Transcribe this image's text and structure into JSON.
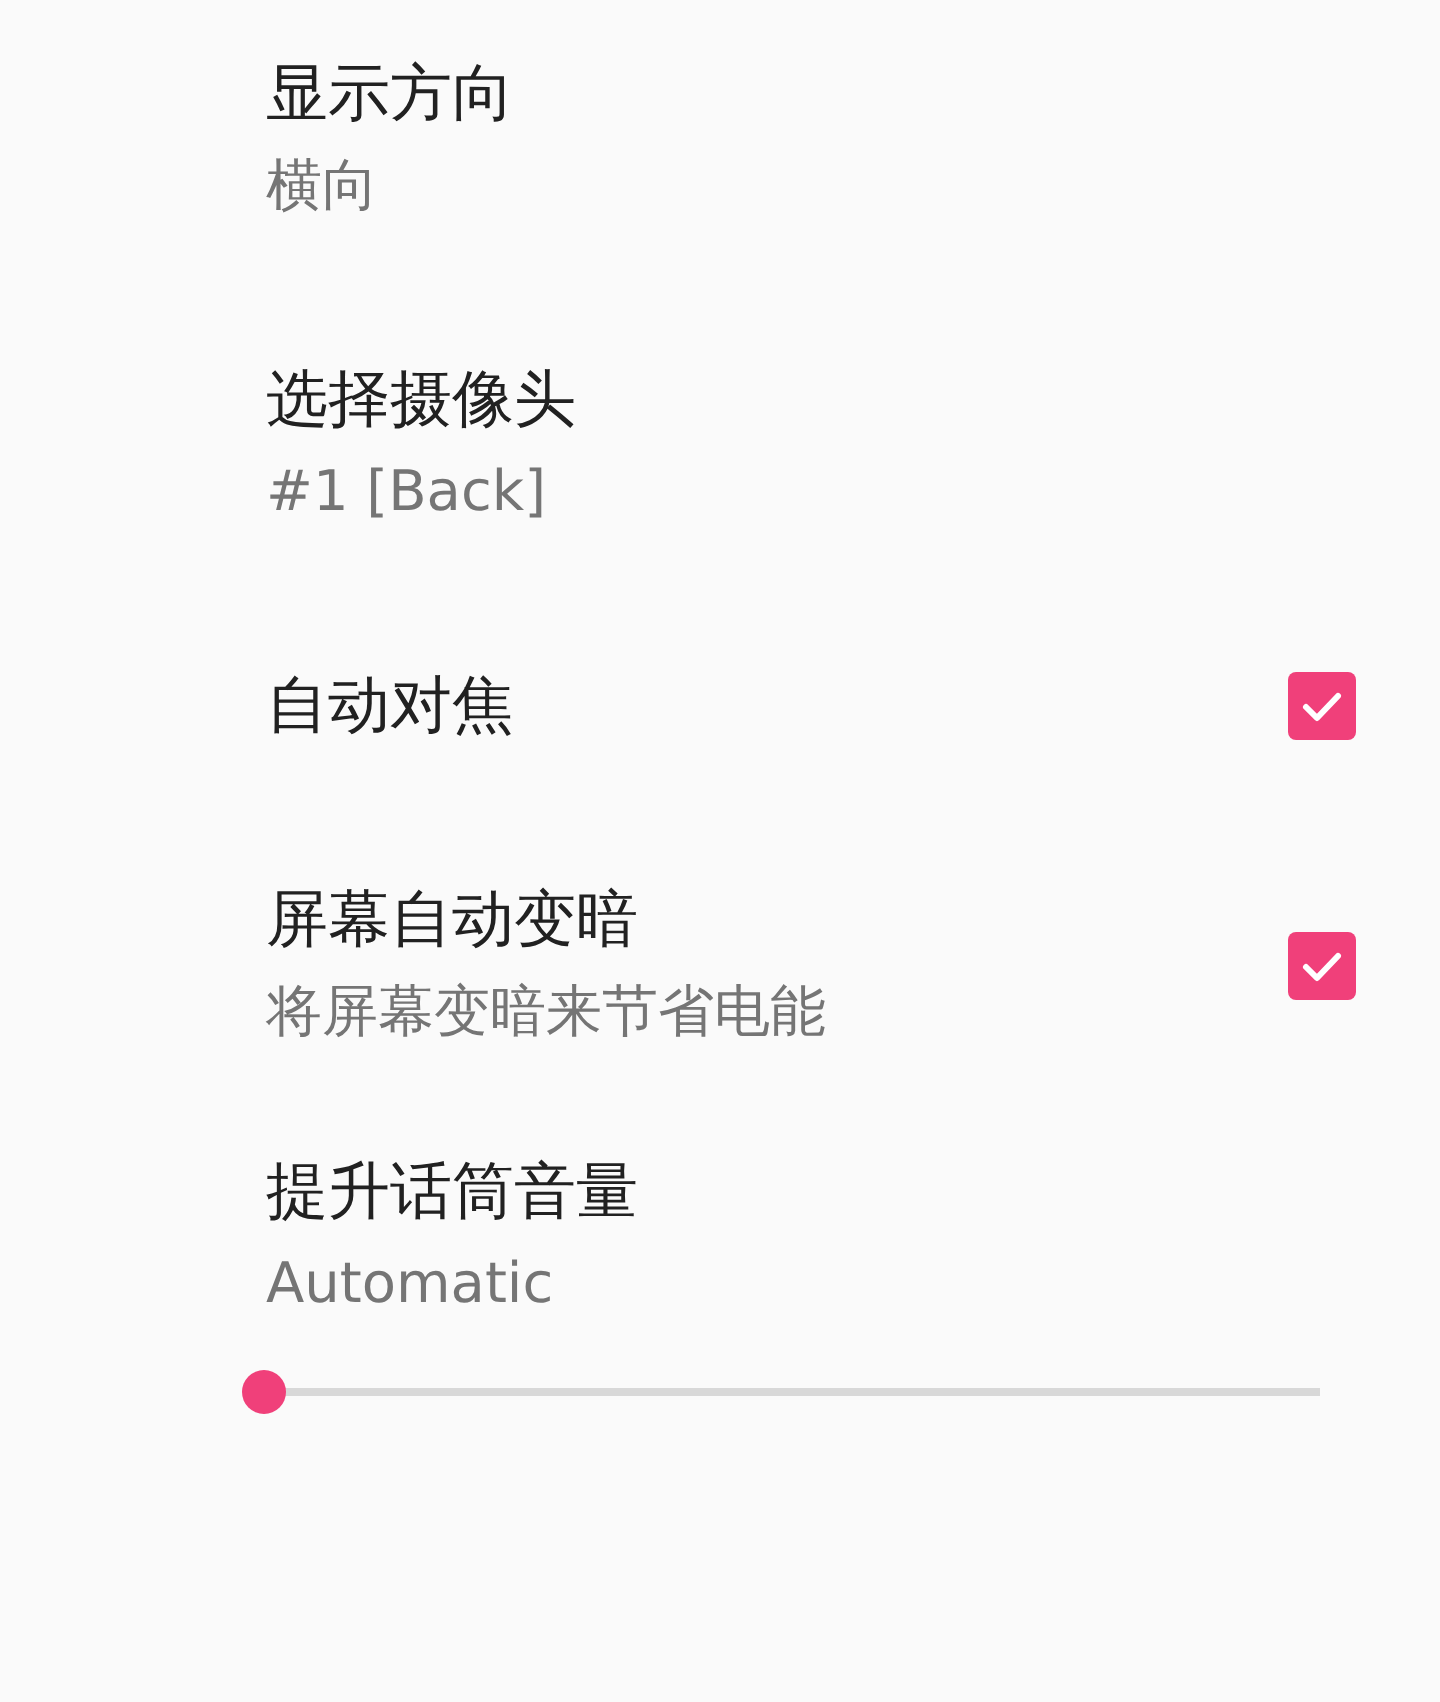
{
  "preferences": [
    {
      "kind": "text",
      "title": "显示方向",
      "summary": "横向"
    },
    {
      "kind": "text",
      "title": "选择摄像头",
      "summary": "#1 [Back]"
    },
    {
      "kind": "checkbox",
      "title": "自动对焦",
      "checked": true
    },
    {
      "kind": "checkbox",
      "title": "屏幕自动变暗",
      "summary": "将屏幕变暗来节省电能",
      "checked": true
    },
    {
      "kind": "slider",
      "title": "提升话筒音量",
      "summary": "Automatic",
      "level": 0
    }
  ]
}
